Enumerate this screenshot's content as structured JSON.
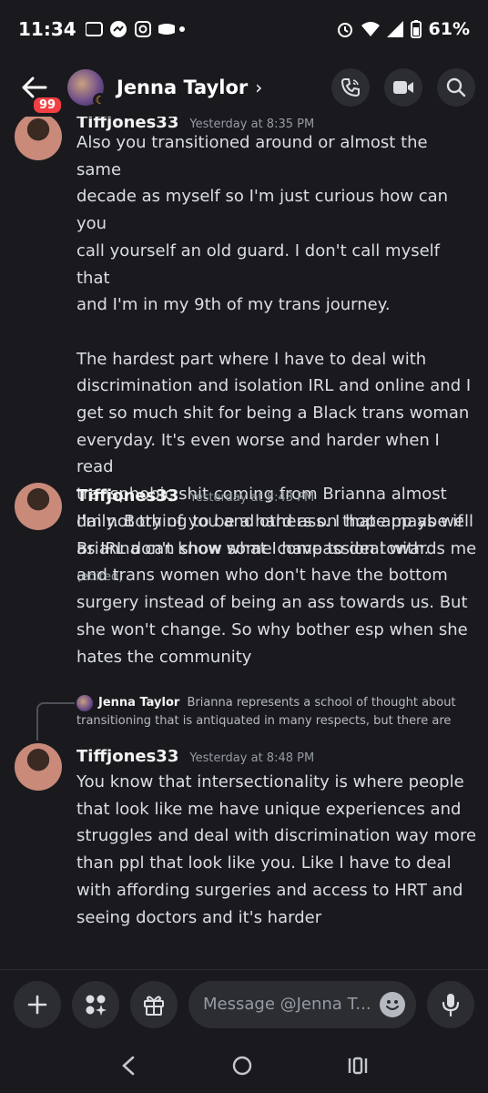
{
  "status_bar": {
    "time": "11:34",
    "battery": "61%"
  },
  "header": {
    "unread_badge": "99",
    "title": "Jenna Taylor",
    "chevron": "›"
  },
  "messages": [
    {
      "username": "Tiffjones33",
      "timestamp": "Yesterday at 8:35 PM",
      "lines": [
        "Also you transitioned around or almost the same",
        "decade as myself so I'm just curious how can you",
        "call yourself an old guard. I don't call myself that",
        "and I'm in my 9th of my trans journey.",
        "",
        "The hardest part where I have to deal with",
        "discrimination and isolation IRL and online  and I",
        "get so much shit for being a Black trans woman",
        "everyday. It's even worse and harder when I read",
        "transphobic shit coming from Brianna almost",
        "daily. Both of you and others on that app as well",
        "as IRL don't know what I have to deal with."
      ],
      "edited": "(edited)"
    },
    {
      "username": "Tiffjones33",
      "timestamp": "Yesterday at 8:43 PM",
      "lines": [
        "I'm not trying to be a hard ass. I hope maybe if",
        "Brianna can show some compassion towards me",
        "and trans women who don't have the bottom",
        "surgery instead of being an ass towards us. But",
        "she won't change. So why bother esp when she",
        "hates the community"
      ]
    },
    {
      "reply_to": {
        "name": "Jenna Taylor",
        "line1": "Brianna represents a school of thought about",
        "line2": "transitioning that is antiquated in many respects, but there are"
      },
      "username": "Tiffjones33",
      "timestamp": "Yesterday at 8:48 PM",
      "lines": [
        "You know that intersectionality is where people",
        "that look like me have unique experiences and",
        "struggles and deal with discrimination way more",
        "than ppl that look like you. Like I have to deal",
        "with affording surgeries and access to HRT and",
        "seeing doctors and it's harder"
      ]
    }
  ],
  "composer": {
    "placeholder": "Message @Jenna T..."
  },
  "icons": {
    "back": "arrow-left-icon",
    "call": "phone-icon",
    "video": "video-camera-icon",
    "search": "search-icon",
    "add": "plus-icon",
    "apps": "apps-icon",
    "gift": "gift-icon",
    "emoji": "emoji-icon",
    "mic": "microphone-icon"
  },
  "colors": {
    "background": "#1a1a1e",
    "badge": "#f23f43",
    "idle": "#f0b232"
  }
}
